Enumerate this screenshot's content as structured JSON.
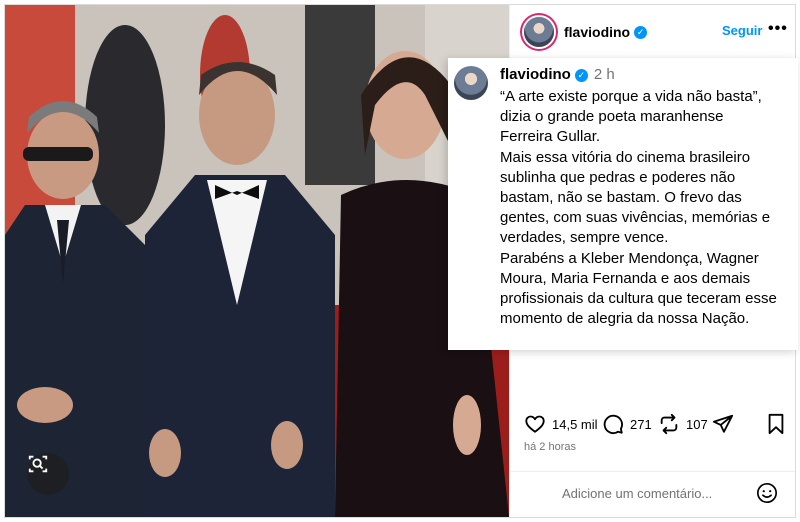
{
  "post": {
    "username": "flaviodino",
    "follow_label": "Seguir",
    "more_label": "•••",
    "time_short": "2 h",
    "caption": "“A arte existe porque a vida não basta”,\ndizia o grande poeta maranhense\nFerreira Gullar.\nMais essa vitória do cinema brasileiro\nsublinha que pedras e poderes não\nbastam, não se bastam. O frevo das\ngentes, com suas vivências, memórias e\nverdades, sempre vence.\nParabéns a Kleber Mendonça, Wagner\nMoura, Maria Fernanda e aos demais\nprofissionais da cultura que teceram esse\nmomento de alegria da nossa Nação.",
    "likes": "14,5 mil",
    "comments": "271",
    "reposts": "107",
    "time_long": "há 2 horas",
    "comment_placeholder": "Adicione um comentário..."
  },
  "icons": {
    "verified": "verified-badge-icon",
    "lens": "visual-search-icon",
    "like": "heart-icon",
    "comment": "comment-bubble-icon",
    "repost": "repost-icon",
    "share": "send-icon",
    "save": "bookmark-icon",
    "emoji": "emoji-icon"
  },
  "colors": {
    "accent": "#0095f6",
    "muted": "#737373",
    "carpet": "#9b1e1a"
  }
}
